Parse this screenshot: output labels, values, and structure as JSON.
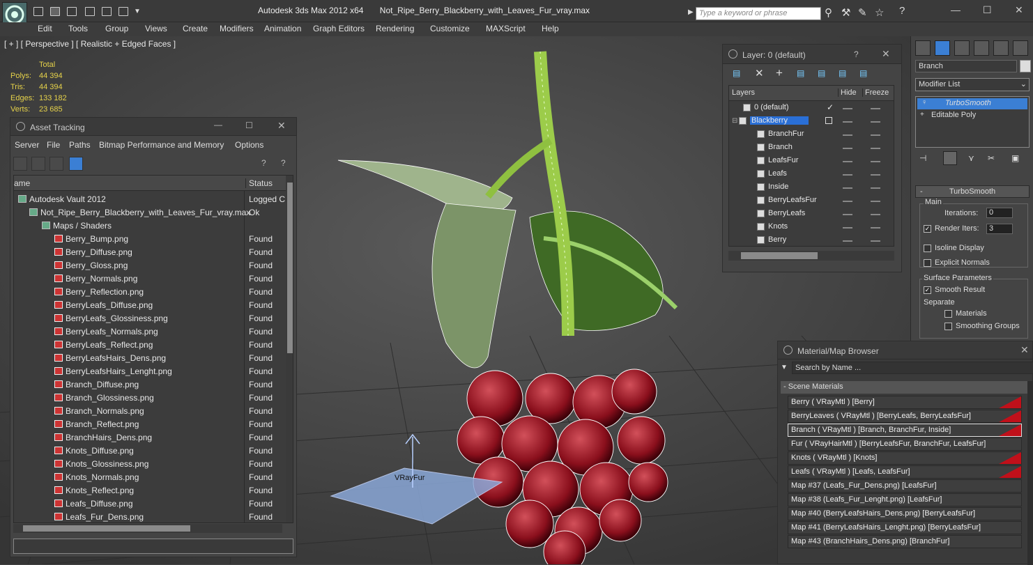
{
  "app": {
    "title": "Autodesk 3ds Max  2012 x64",
    "filename": "Not_Ripe_Berry_Blackberry_with_Leaves_Fur_vray.max",
    "search_placeholder": "Type a keyword or phrase"
  },
  "menu": [
    "Edit",
    "Tools",
    "Group",
    "Views",
    "Create",
    "Modifiers",
    "Animation",
    "Graph Editors",
    "Rendering",
    "Customize",
    "MAXScript",
    "Help"
  ],
  "viewport": {
    "label": "[ + ] [ Perspective ] [ Realistic + Edged Faces ]",
    "stats": {
      "header": "Total",
      "rows": [
        {
          "label": "Polys:",
          "value": "44 394"
        },
        {
          "label": "Tris:",
          "value": "44 394"
        },
        {
          "label": "Edges:",
          "value": "133 182"
        },
        {
          "label": "Verts:",
          "value": "23 685"
        }
      ]
    },
    "helper_label": "VRayFur"
  },
  "asset_tracking": {
    "title": "Asset Tracking",
    "menu": [
      "Server",
      "File",
      "Paths",
      "Bitmap Performance and Memory",
      "Options"
    ],
    "col_name": "ame",
    "col_status": "Status",
    "vault": {
      "name": "Autodesk Vault 2012",
      "status": "Logged C"
    },
    "maxfile": {
      "name": "Not_Ripe_Berry_Blackberry_with_Leaves_Fur_vray.max",
      "status": "Ok"
    },
    "maps_folder": "Maps / Shaders",
    "files": [
      {
        "name": "Berry_Bump.png",
        "status": "Found"
      },
      {
        "name": "Berry_Diffuse.png",
        "status": "Found"
      },
      {
        "name": "Berry_Gloss.png",
        "status": "Found"
      },
      {
        "name": "Berry_Normals.png",
        "status": "Found"
      },
      {
        "name": "Berry_Reflection.png",
        "status": "Found"
      },
      {
        "name": "BerryLeafs_Diffuse.png",
        "status": "Found"
      },
      {
        "name": "BerryLeafs_Glossiness.png",
        "status": "Found"
      },
      {
        "name": "BerryLeafs_Normals.png",
        "status": "Found"
      },
      {
        "name": "BerryLeafs_Reflect.png",
        "status": "Found"
      },
      {
        "name": "BerryLeafsHairs_Dens.png",
        "status": "Found"
      },
      {
        "name": "BerryLeafsHairs_Lenght.png",
        "status": "Found"
      },
      {
        "name": "Branch_Diffuse.png",
        "status": "Found"
      },
      {
        "name": "Branch_Glossiness.png",
        "status": "Found"
      },
      {
        "name": "Branch_Normals.png",
        "status": "Found"
      },
      {
        "name": "Branch_Reflect.png",
        "status": "Found"
      },
      {
        "name": "BranchHairs_Dens.png",
        "status": "Found"
      },
      {
        "name": "Knots_Diffuse.png",
        "status": "Found"
      },
      {
        "name": "Knots_Glossiness.png",
        "status": "Found"
      },
      {
        "name": "Knots_Normals.png",
        "status": "Found"
      },
      {
        "name": "Knots_Reflect.png",
        "status": "Found"
      },
      {
        "name": "Leafs_Diffuse.png",
        "status": "Found"
      },
      {
        "name": "Leafs_Fur_Dens.png",
        "status": "Found"
      }
    ]
  },
  "layers": {
    "title": "Layer: 0 (default)",
    "help": "?",
    "col_layers": "Layers",
    "col_hide": "Hide",
    "col_freeze": "Freeze",
    "items": [
      {
        "name": "0 (default)"
      },
      {
        "name": "Blackberry"
      },
      {
        "name": "BranchFur"
      },
      {
        "name": "Branch"
      },
      {
        "name": "LeafsFur"
      },
      {
        "name": "Leafs"
      },
      {
        "name": "Inside"
      },
      {
        "name": "BerryLeafsFur"
      },
      {
        "name": "BerryLeafs"
      },
      {
        "name": "Knots"
      },
      {
        "name": "Berry"
      }
    ]
  },
  "command_panel": {
    "object_name": "Branch",
    "modifier_list": "Modifier List",
    "stack": [
      "TurboSmooth",
      "Editable Poly"
    ],
    "rollout_title": "TurboSmooth",
    "main_label": "Main",
    "iterations_label": "Iterations:",
    "iterations_value": "0",
    "render_iters_label": "Render Iters:",
    "render_iters_value": "3",
    "isoline_label": "Isoline Display",
    "explicit_label": "Explicit Normals",
    "surface_label": "Surface Parameters",
    "smooth_label": "Smooth Result",
    "separate_label": "Separate",
    "materials_label": "Materials",
    "smoothing_label": "Smoothing Groups"
  },
  "material_browser": {
    "title": "Material/Map Browser",
    "search_placeholder": "Search by Name ...",
    "section": "- Scene Materials",
    "items": [
      {
        "label": "Berry  ( VRayMtl )  [Berry]",
        "swatch": true
      },
      {
        "label": "BerryLeaves  ( VRayMtl )  [BerryLeafs, BerryLeafsFur]",
        "swatch": true
      },
      {
        "label": "Branch  ( VRayMtl )  [Branch, BranchFur, Inside]",
        "swatch": true
      },
      {
        "label": "Fur  ( VRayHairMtl )  [BerryLeafsFur, BranchFur, LeafsFur]",
        "swatch": false
      },
      {
        "label": "Knots  ( VRayMtl )  [Knots]",
        "swatch": true
      },
      {
        "label": "Leafs  ( VRayMtl )  [Leafs, LeafsFur]",
        "swatch": true
      },
      {
        "label": "Map #37 (Leafs_Fur_Dens.png)  [LeafsFur]",
        "swatch": false
      },
      {
        "label": "Map #38 (Leafs_Fur_Lenght.png)  [LeafsFur]",
        "swatch": false
      },
      {
        "label": "Map #40 (BerryLeafsHairs_Dens.png)  [BerryLeafsFur]",
        "swatch": false
      },
      {
        "label": "Map #41 (BerryLeafsHairs_Lenght.png)  [BerryLeafsFur]",
        "swatch": false
      },
      {
        "label": "Map #43 (BranchHairs_Dens.png)  [BranchFur]",
        "swatch": false
      }
    ]
  },
  "colors": {
    "selection": "#2a6fd6",
    "swatch": "#c0101a",
    "stats": "#e6d24a"
  }
}
